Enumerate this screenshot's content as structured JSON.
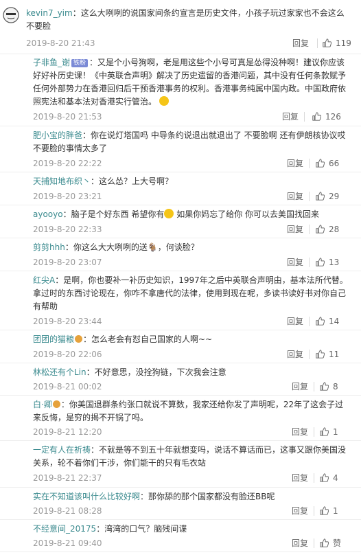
{
  "reply_label": "回复",
  "comments": [
    {
      "user": "kevin7_yim",
      "text": "：这么大咧咧的说国家间条约宣言是历史文件，小孩子玩过家家也不会这么不要脸",
      "date": "2019-8-20 21:43",
      "likes": "119"
    },
    {
      "user": "子非鱼_谢",
      "badge": "铁粉",
      "text": "：又是个小号狗啊，老是用这些个小号可真是怂得没种啊！建议你应该好好补历史课！《中英联合声明》解决了历史遗留的香港问题，其中没有任何条款赋予任何外部势力在香港回归后干预香港事务的权利。香港事务纯属中国内政。中国政府依照宪法和基本法对香港实行管治。",
      "date": "2019-8-20 21:53",
      "likes": "126"
    },
    {
      "user": "肥小宝的胖爸",
      "text": "：你在说灯塔国吗 中导条约说退出就退出了 不要脸啊 还有伊朗核协议哎 不要脸的事情太多了",
      "date": "2019-8-20 22:22",
      "likes": "66"
    },
    {
      "user": "天捕知地布织丶",
      "text": "：这么怂？上大号啊？",
      "date": "2019-8-20 23:21",
      "likes": "29"
    },
    {
      "user": "ayooyo",
      "text_a": "：脑子是个好东西 希望你有",
      "text_b": " 如果你妈忘了给你 你可以去美国找回来",
      "date": "2019-8-20 22:33",
      "likes": "28"
    },
    {
      "user": "剪剪hhh",
      "text": "：你这么大大咧咧的送🐐，何谈脸？",
      "date": "2019-8-20 23:07",
      "likes": "13"
    },
    {
      "user": "红尖A",
      "text": "：是啊，你也要补一补历史知识，1997年之后中英联合声明由，基本法所代替。拿过时的东西讨论现在，你咋不拿唐代的法律，使用到现在呢，多读书读好书对你自己有帮助",
      "date": "2019-8-20 23:44",
      "likes": "14"
    },
    {
      "user": "团团的猫粮",
      "text": "：怎么老会有怼自己国家的人啊~~",
      "date": "2019-8-20 22:06",
      "likes": "11"
    },
    {
      "user": "林松还有个Lin",
      "text": "：不好意思，没拴狗链，下次我会注意",
      "date": "2019-8-21 00:02",
      "likes": "8"
    },
    {
      "user": "白·卿",
      "text": "：你美国退群条约张口就说不算数，我家还给你发了声明呢，22年了这会子过来反悔，是穷的揭不开锅了吗。",
      "date": "2019-8-21 12:20",
      "likes": "1"
    },
    {
      "user": "一定有人在祈祷",
      "text": "：不就是等不到五十年就想变吗，说话不算话而已，这事又跟你美国没关系，轮不着你们干涉，你们能干的只有毛衣站",
      "date": "2019-8-21 22:37",
      "likes": "4"
    },
    {
      "user": "实在不知道该叫什么比较好啊",
      "text": "：那你舔的那个国家都没有脸还BB呢",
      "date": "2019-8-21 08:28",
      "likes": "1"
    },
    {
      "user": "不经意间_20175",
      "text": "：湾湾的口气？脑残间谍",
      "date": "2019-8-21 09:40",
      "likes": "赞"
    }
  ]
}
